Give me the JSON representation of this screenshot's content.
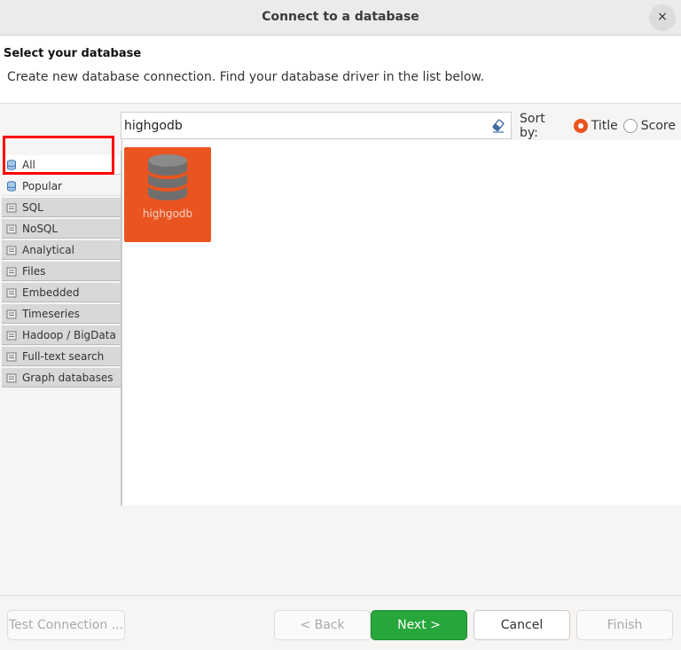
{
  "window": {
    "title": "Connect to a database",
    "close_glyph": "×"
  },
  "header": {
    "title": "Select your database",
    "description": "Create new database connection. Find your database driver in the list below."
  },
  "search": {
    "value": "highgodb",
    "clear_icon": "eraser-icon"
  },
  "sort": {
    "label": "Sort by:",
    "options": [
      {
        "label": "Title",
        "selected": true
      },
      {
        "label": "Score",
        "selected": false
      }
    ]
  },
  "categories": [
    {
      "label": "All",
      "icon": "database-icon",
      "selected": true
    },
    {
      "label": "Popular",
      "icon": "database-icon"
    },
    {
      "label": "SQL",
      "icon": "folder-icon"
    },
    {
      "label": "NoSQL",
      "icon": "folder-icon"
    },
    {
      "label": "Analytical",
      "icon": "folder-icon"
    },
    {
      "label": "Files",
      "icon": "folder-icon"
    },
    {
      "label": "Embedded",
      "icon": "folder-icon"
    },
    {
      "label": "Timeseries",
      "icon": "folder-icon"
    },
    {
      "label": "Hadoop / BigData",
      "icon": "folder-icon"
    },
    {
      "label": "Full-text search",
      "icon": "folder-icon"
    },
    {
      "label": "Graph databases",
      "icon": "folder-icon"
    }
  ],
  "results": [
    {
      "name": "highgodb",
      "icon": "database-icon",
      "color": "#e95420"
    }
  ],
  "buttons": {
    "test_connection": "Test Connection ...",
    "back": "< Back",
    "next": "Next >",
    "cancel": "Cancel",
    "finish": "Finish"
  },
  "colors": {
    "accent": "#e95420",
    "primary_button": "#26a63b",
    "highlight": "#ff0000"
  }
}
